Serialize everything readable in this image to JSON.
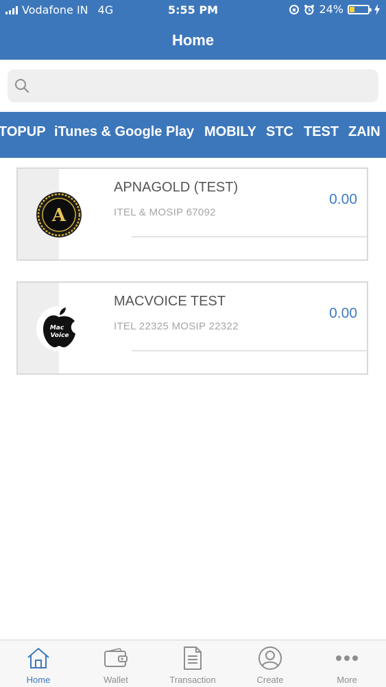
{
  "status_bar": {
    "carrier": "Vodafone IN",
    "network": "4G",
    "time": "5:55 PM",
    "battery": "24%",
    "battery_level": 0.24
  },
  "nav": {
    "title": "Home"
  },
  "search": {
    "placeholder": "",
    "value": ""
  },
  "categories": [
    "TOPUP",
    "iTunes & Google Play",
    "MOBILY",
    "STC",
    "TEST",
    "ZAIN"
  ],
  "items": [
    {
      "name": "APNAGOLD (TEST)",
      "subtitle": "ITEL & MOSIP 67092",
      "amount": "0.00",
      "logo_letter": "A",
      "logo_icon": "apnagold-logo"
    },
    {
      "name": "MACVOICE TEST",
      "subtitle": "ITEL 22325 MOSIP 22322",
      "amount": "0.00",
      "logo_text": "Mac Voice",
      "logo_icon": "macvoice-apple-logo"
    }
  ],
  "tabbar": {
    "items": [
      {
        "label": "Home",
        "icon": "home-icon",
        "active": true
      },
      {
        "label": "Wallet",
        "icon": "wallet-icon"
      },
      {
        "label": "Transaction",
        "icon": "document-icon"
      },
      {
        "label": "Create",
        "icon": "user-icon"
      },
      {
        "label": "More",
        "icon": "more-icon"
      }
    ]
  },
  "colors": {
    "primary": "#3d77bb",
    "amount": "#3d7bc0",
    "active_tab": "#3d77bb"
  }
}
